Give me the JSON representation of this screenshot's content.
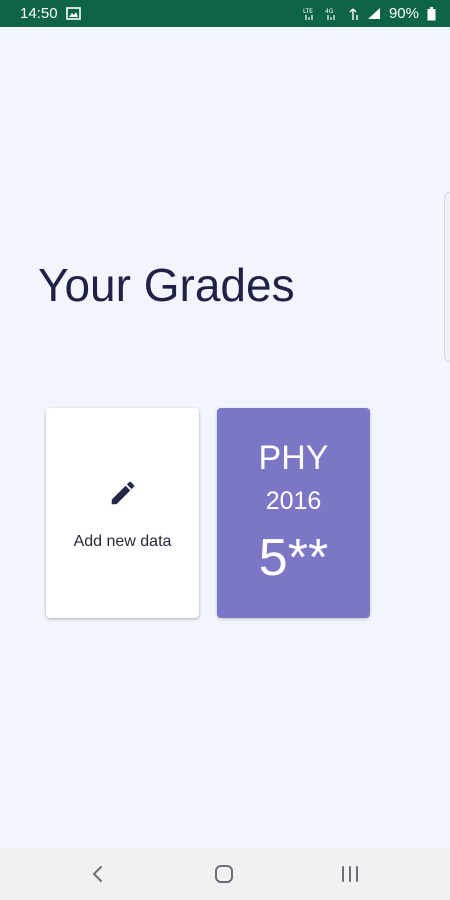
{
  "status_bar": {
    "time": "14:50",
    "battery_percent": "90%",
    "icons": [
      "image-icon",
      "lte-icon",
      "lte-icon",
      "wifi-icon",
      "signal-icon",
      "battery-icon"
    ]
  },
  "page": {
    "title": "Your Grades"
  },
  "add_card": {
    "label": "Add new data",
    "icon": "pencil-icon"
  },
  "grade_cards": [
    {
      "subject": "PHY",
      "year": "2016",
      "grade": "5**",
      "color": "#7b76c6"
    }
  ],
  "nav_bar": {
    "buttons": [
      "back-icon",
      "home-icon",
      "recents-icon"
    ]
  },
  "colors": {
    "status_bar": "#0e6446",
    "background": "#f1f6fc",
    "title": "#1f2147"
  }
}
